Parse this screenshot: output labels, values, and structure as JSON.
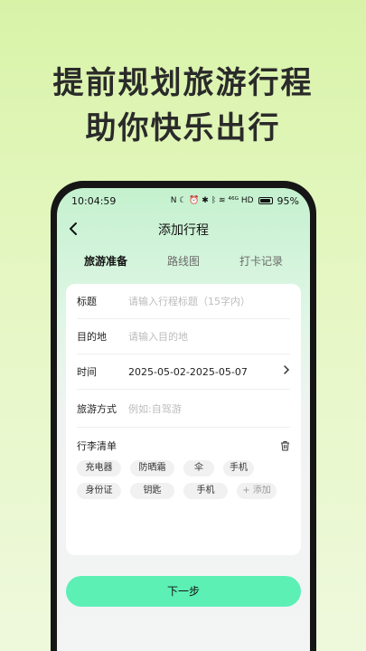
{
  "promo": {
    "line1": "提前规划旅游行程",
    "line2": "助你快乐出行"
  },
  "status": {
    "time": "10:04:59",
    "icons_text": "N ☾ ⏰ ✱ ᛒ ≋ ⁴⁶ᴳ HD",
    "battery": "95%"
  },
  "navbar": {
    "back_icon": "chevron-left-icon",
    "title": "添加行程"
  },
  "tabs": [
    {
      "label": "旅游准备",
      "active": true
    },
    {
      "label": "路线图",
      "active": false
    },
    {
      "label": "打卡记录",
      "active": false
    }
  ],
  "form": {
    "title_label": "标题",
    "title_placeholder": "请输入行程标题（15字内）",
    "dest_label": "目的地",
    "dest_placeholder": "请输入目的地",
    "time_label": "时间",
    "time_value": "2025-05-02-2025-05-07",
    "mode_label": "旅游方式",
    "mode_placeholder": "例如:自驾游"
  },
  "luggage": {
    "label": "行李清单",
    "items": [
      "充电器",
      "防晒霜",
      "伞",
      "手机",
      "身份证",
      "钥匙",
      "手机"
    ],
    "add_label": "+ 添加"
  },
  "next_button": "下一步",
  "colors": {
    "accent": "#5cf0b4",
    "background_top": "#d8f3a8"
  }
}
